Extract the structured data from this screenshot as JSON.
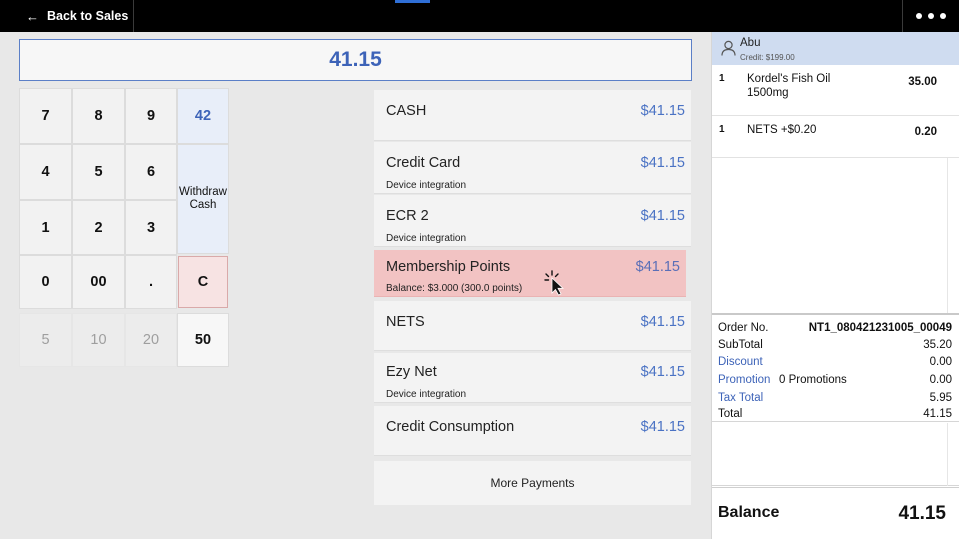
{
  "header": {
    "back_label": "Back to Sales"
  },
  "amount": "41.15",
  "keypad": {
    "keys": [
      "7",
      "8",
      "9",
      "4",
      "5",
      "6",
      "1",
      "2",
      "3",
      "0",
      "00",
      "."
    ],
    "quick_amount": "42",
    "withdraw_line1": "Withdraw",
    "withdraw_line2": "Cash",
    "clear": "C",
    "presets": [
      "5",
      "10",
      "20",
      "50"
    ]
  },
  "payments": [
    {
      "name": "CASH",
      "amount": "$41.15",
      "sub": ""
    },
    {
      "name": "Credit Card",
      "amount": "$41.15",
      "sub": "Device integration"
    },
    {
      "name": "ECR 2",
      "amount": "$41.15",
      "sub": "Device integration"
    },
    {
      "name": "Membership Points",
      "amount": "$41.15",
      "sub": "Balance: $3.000 (300.0 points)"
    },
    {
      "name": "NETS",
      "amount": "$41.15",
      "sub": ""
    },
    {
      "name": "Ezy Net",
      "amount": "$41.15",
      "sub": "Device integration"
    },
    {
      "name": "Credit Consumption",
      "amount": "$41.15",
      "sub": ""
    }
  ],
  "more_payments": "More Payments",
  "customer": {
    "name": "Abu",
    "credit": "Credit: $199.00"
  },
  "order_lines": [
    {
      "qty": "1",
      "name": "Kordel's Fish Oil 1500mg",
      "amount": "35.00"
    },
    {
      "qty": "1",
      "name": "NETS +$0.20",
      "amount": "0.20"
    }
  ],
  "totals": {
    "order_no_label": "Order No.",
    "order_no": "NT1_080421231005_00049",
    "subtotal_label": "SubTotal",
    "subtotal": "35.20",
    "discount_label": "Discount",
    "discount": "0.00",
    "promotion_label": "Promotion",
    "promotion_count": "0 Promotions",
    "promotion": "0.00",
    "tax_label": "Tax Total",
    "tax": "5.95",
    "total_label": "Total",
    "total": "41.15"
  },
  "balance": {
    "label": "Balance",
    "value": "41.15"
  },
  "colors": {
    "accent": "#3d63b8",
    "selected_payment": "#f2c3c3",
    "customer_bar": "#cfdcf0"
  }
}
